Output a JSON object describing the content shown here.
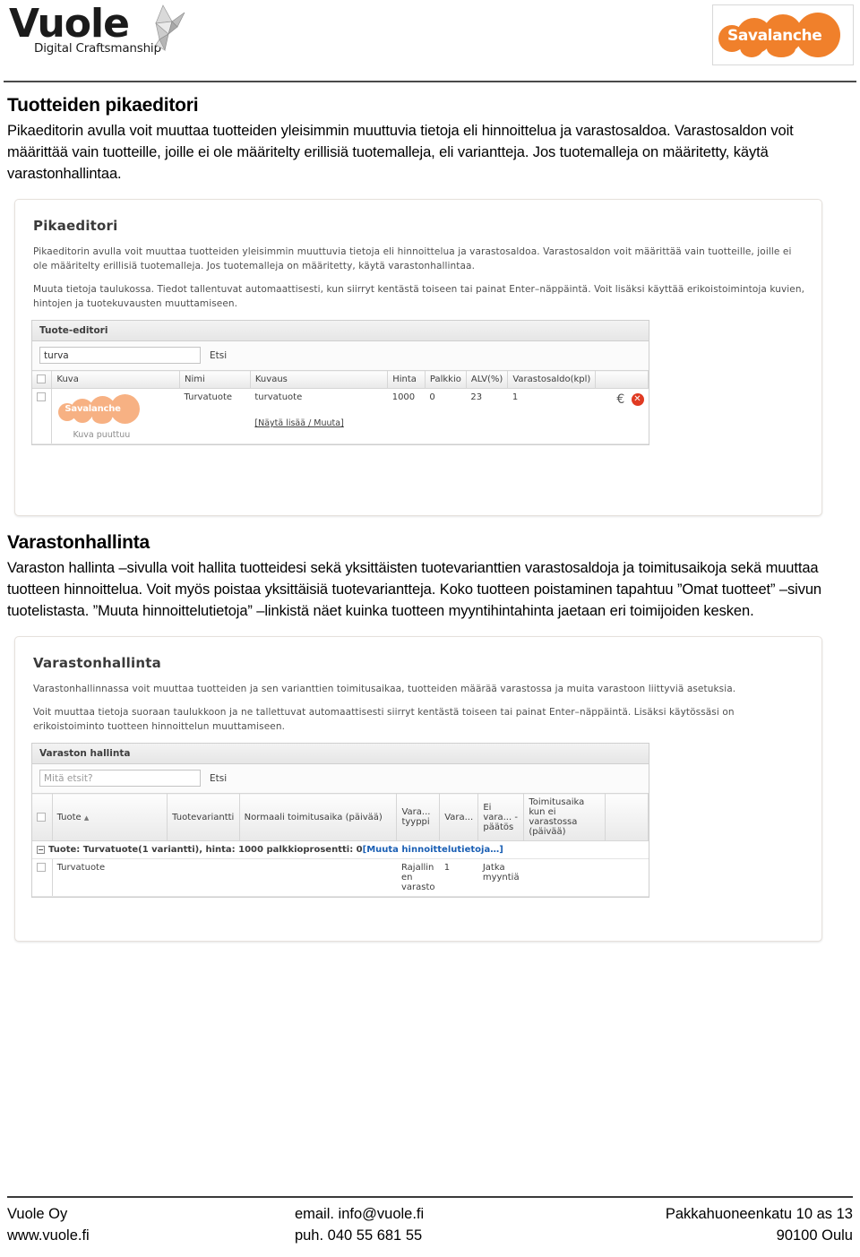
{
  "header": {
    "logo_wordmark": "Vuole",
    "logo_tagline": "Digital Craftsmanship",
    "partner_logo_text": "Savalanche"
  },
  "doc": {
    "section1": {
      "title": "Tuotteiden pikaeditori",
      "paragraph": "Pikaeditorin avulla voit muuttaa tuotteiden yleisimmin muuttuvia tietoja eli hinnoittelua ja varastosaldoa. Varastosaldon voit määrittää vain tuotteille, joille ei ole määritelty erillisiä tuotemalleja, eli variantteja. Jos tuotemalleja on määritetty, käytä varastonhallintaa."
    },
    "section2": {
      "title": "Varastonhallinta",
      "paragraph": "Varaston hallinta –sivulla voit hallita tuotteidesi sekä yksittäisten tuotevarianttien varastosaldoja ja toimitusaikoja sekä muuttaa tuotteen hinnoittelua. Voit myös poistaa yksittäisiä tuotevariantteja. Koko tuotteen poistaminen tapahtuu ”Omat tuotteet” –sivun tuotelistasta.  ”Muuta hinnoittelutietoja” –linkistä näet kuinka tuotteen myyntihintahinta jaetaan eri toimijoiden kesken."
    }
  },
  "screenshot1": {
    "title": "Pikaeditori",
    "intro1": "Pikaeditorin avulla voit muuttaa tuotteiden yleisimmin muuttuvia tietoja eli hinnoittelua ja varastosaldoa. Varastosaldon voit määrittää vain tuotteille, joille ei ole määritelty erillisiä tuotemalleja. Jos tuotemalleja on määritetty, käytä varastonhallintaa.",
    "intro2": "Muuta tietoja taulukossa. Tiedot tallentuvat automaattisesti, kun siirryt kentästä toiseen tai painat Enter–näppäintä. Voit lisäksi käyttää erikoistoimintoja kuvien, hintojen ja tuotekuvausten muuttamiseen.",
    "widget_title": "Tuote-editori",
    "search_value": "turva",
    "search_button": "Etsi",
    "columns": [
      "Kuva",
      "Nimi",
      "Kuvaus",
      "Hinta",
      "Palkkio",
      "ALV(%)",
      "Varastosaldo(kpl)"
    ],
    "row": {
      "nimi": "Turvatuote",
      "kuvaus": "turvatuote",
      "hinta": "1000",
      "palkkio": "0",
      "alv": "23",
      "varastosaldo": "1",
      "thumb_text": "Savalanche",
      "thumb_caption": "Kuva puuttuu",
      "details_link": "[Näytä lisää / Muuta]",
      "euro_icon": "€",
      "delete_icon": "✕"
    }
  },
  "screenshot2": {
    "title": "Varastonhallinta",
    "intro1": "Varastonhallinnassa voit muuttaa tuotteiden ja sen varianttien toimitusaikaa, tuotteiden määrää varastossa ja muita varastoon liittyviä asetuksia.",
    "intro2": "Voit muuttaa tietoja suoraan taulukkoon ja ne tallettuvat automaattisesti siirryt kentästä toiseen tai painat Enter–näppäintä. Lisäksi käytössäsi on erikoistoiminto tuotteen hinnoittelun muuttamiseen.",
    "widget_title": "Varaston hallinta",
    "search_placeholder": "Mitä etsit?",
    "search_button": "Etsi",
    "columns": [
      "Tuote",
      "Tuotevariantti",
      "Normaali toimitusaika (päivää)",
      "Vara... tyyppi",
      "Vara...",
      "Ei vara... -päätös",
      "Toimitusaika kun ei varastossa (päivää)"
    ],
    "sort_arrow": "▲",
    "group_row": {
      "toggle": "−",
      "text": "Tuote: Turvatuote(1 variantti), hinta: 1000 palkkioprosentti: 0",
      "link": "[Muuta hinnoittelutietoja…]"
    },
    "row": {
      "tuote": "Turvatuote",
      "varastotyyppi": "Rajallin en varasto",
      "varasto": "1",
      "ei_varastossa_paatos": "Jatka myyntiä"
    }
  },
  "footer": {
    "company": "Vuole Oy",
    "website": "www.vuole.fi",
    "email": "email. info@vuole.fi",
    "phone": "puh. 040 55 681 55",
    "address": "Pakkahuoneenkatu 10 as 13",
    "city": "90100 Oulu"
  }
}
